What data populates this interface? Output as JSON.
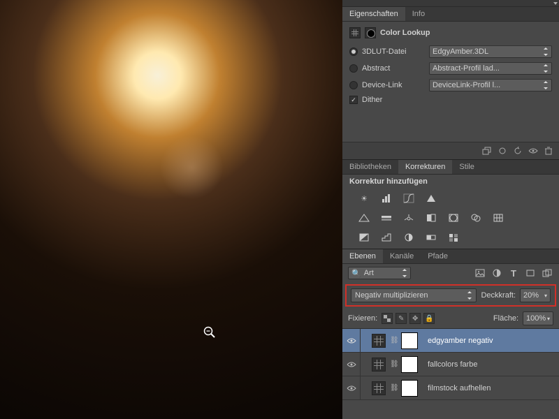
{
  "properties_panel": {
    "tabs": [
      "Eigenschaften",
      "Info"
    ],
    "active_tab": 0,
    "title": "Color Lookup",
    "rows": [
      {
        "type": "radio",
        "label": "3DLUT-Datei",
        "value": "EdgyAmber.3DL",
        "selected": true
      },
      {
        "type": "radio",
        "label": "Abstract",
        "value": "Abstract-Profil lad...",
        "selected": false
      },
      {
        "type": "radio",
        "label": "Device-Link",
        "value": "DeviceLink-Profil l...",
        "selected": false
      },
      {
        "type": "check",
        "label": "Dither",
        "selected": true
      }
    ],
    "footer_icons": [
      "clip-icon",
      "view-icon",
      "undo-icon",
      "eye-icon",
      "trash-icon"
    ]
  },
  "adjustments_panel": {
    "tabs": [
      "Bibliotheken",
      "Korrekturen",
      "Stile"
    ],
    "active_tab": 1,
    "heading": "Korrektur hinzufügen",
    "row1_icons": [
      "brightness-icon",
      "levels-icon",
      "curves-icon",
      "exposure-icon"
    ],
    "row2_icons": [
      "vibrance-icon",
      "hue-icon",
      "colorbalance-icon",
      "bw-icon",
      "photofilter-icon",
      "mixer-icon",
      "lut-icon"
    ],
    "row3_icons": [
      "invert-icon",
      "posterize-icon",
      "threshold-icon",
      "gradientmap-icon",
      "selectivecolor-icon"
    ]
  },
  "layers_panel": {
    "tabs": [
      "Ebenen",
      "Kanäle",
      "Pfade"
    ],
    "active_tab": 0,
    "filter_label": "Art",
    "filter_placeholder": "🔍",
    "type_icons": [
      "image-icon",
      "adjust-icon",
      "type-icon",
      "shape-icon",
      "smart-icon"
    ],
    "blend_mode": "Negativ multiplizieren",
    "opacity_label": "Deckkraft:",
    "opacity_value": "20%",
    "lock_label": "Fixieren:",
    "fill_label": "Fläche:",
    "fill_value": "100%",
    "layers": [
      {
        "visible": true,
        "name": "edgyamber negativ",
        "selected": true,
        "kind": "adjustment"
      },
      {
        "visible": true,
        "name": "fallcolors farbe",
        "selected": false,
        "kind": "adjustment"
      },
      {
        "visible": true,
        "name": "filmstock aufhellen",
        "selected": false,
        "kind": "adjustment"
      }
    ]
  }
}
